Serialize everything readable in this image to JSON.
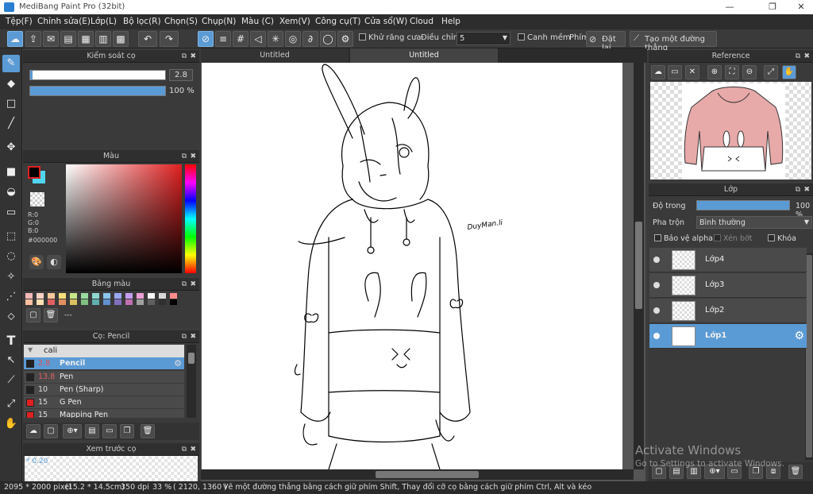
{
  "window": {
    "title": "MediBang Paint Pro (32bit)",
    "min": "—",
    "max": "❐",
    "close": "✕"
  },
  "menu": [
    "Tệp(F)",
    "Chỉnh sửa(E)",
    "Lớp(L)",
    "Bộ lọc(R)",
    "Chọn(S)",
    "Chụp(N)",
    "Màu (C)",
    "Xem(V)",
    "Công cụ(T)",
    "Cửa sổ(W)",
    "Cloud",
    "Help"
  ],
  "toolbar": {
    "antialias": "Khử răng cưa",
    "adjust_label": "Điều chỉnh",
    "adjust_value": "5",
    "snap": "Canh mềm",
    "shortcut_label": "Phím",
    "reset": "Đặt lại",
    "new_line": "Tạo một đường thẳng"
  },
  "tabs": [
    "Untitled",
    "Untitled"
  ],
  "brush_control": {
    "title": "Kiểm soát cọ",
    "size": "2.8",
    "opacity": "100 %"
  },
  "color_panel": {
    "title": "Màu",
    "r": "R:0",
    "g": "G:0",
    "b": "B:0",
    "hex": "#000000"
  },
  "palette_panel": {
    "title": "Bảng màu",
    "dash": "---"
  },
  "brush_panel": {
    "title": "Cọ: Pencil",
    "group": "cali",
    "items": [
      {
        "size": "2.8",
        "name": "Pencil",
        "color": "#222222"
      },
      {
        "size": "13.8",
        "name": "Pen",
        "color": "#222222"
      },
      {
        "size": "10",
        "name": "Pen (Sharp)",
        "color": "#222222"
      },
      {
        "size": "15",
        "name": "G Pen",
        "color": "#e02020"
      },
      {
        "size": "15",
        "name": "Mapping Pen",
        "color": "#e02020"
      }
    ]
  },
  "preview_panel": {
    "title": "Xem trước cọ",
    "value": "* 0.20"
  },
  "reference_panel": {
    "title": "Reference"
  },
  "layer_panel": {
    "title": "Lớp",
    "opacity_label": "Độ trong",
    "opacity_value": "100 %",
    "blend_label": "Pha trộn",
    "blend_value": "Bình thường",
    "protect_alpha": "Bảo vệ alpha",
    "clip": "Xén bớt",
    "lock": "Khóa",
    "layers": [
      "Lớp4",
      "Lớp3",
      "Lớp2",
      "Lớp1"
    ]
  },
  "signature": "DuyMan.li",
  "status": {
    "size": "2095 * 2000 pixel",
    "cm": "(15.2 * 14.5cm)",
    "dpi": "350 dpi",
    "zoom": "33 %",
    "coords": "( 2120, 1360 )",
    "hint": "Vẽ một đường thẳng bằng cách giữ phím Shift, Thay đổi cỡ cọ bằng cách giữ phím Ctrl, Alt và kéo"
  },
  "watermark": {
    "line1": "Activate Windows",
    "line2": "Go to Settings to activate Windows."
  }
}
